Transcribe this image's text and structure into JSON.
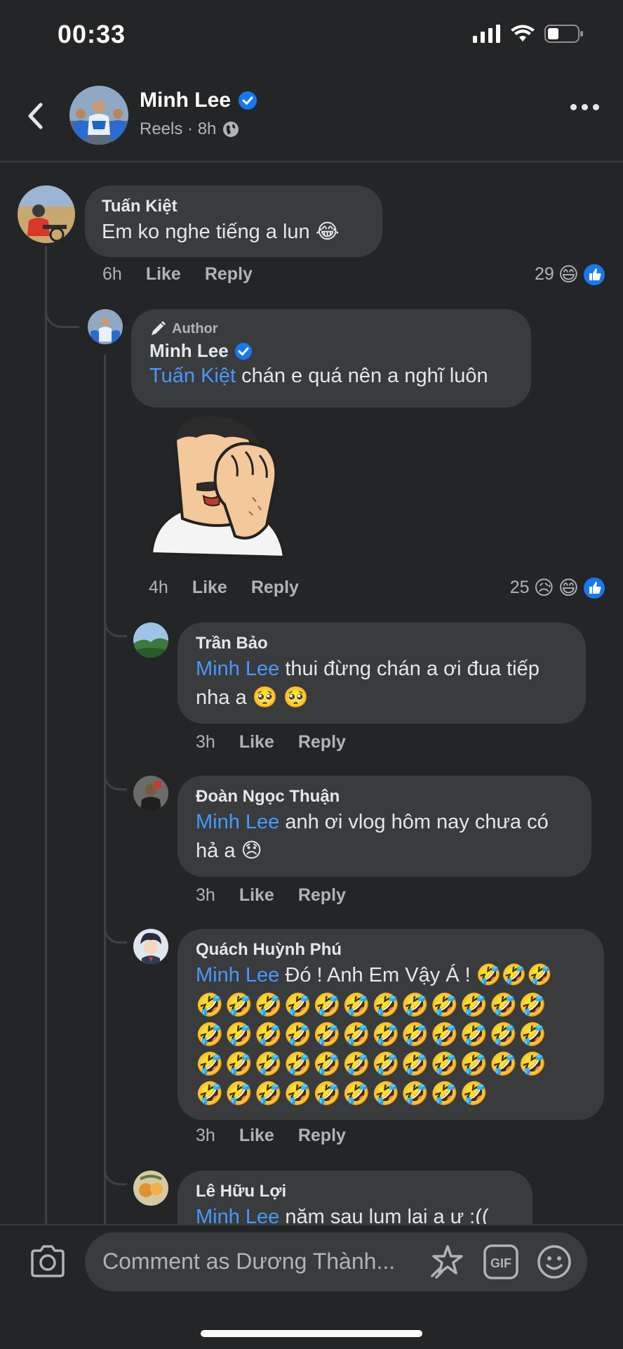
{
  "status_bar": {
    "time": "00:33"
  },
  "header": {
    "name": "Minh Lee",
    "subtitle": "Reels · 8h",
    "verified": true
  },
  "comments": [
    {
      "author": "Tuấn Kiệt",
      "text": "Em ko nghe tiếng a lun 😂",
      "time": "6h",
      "like": "Like",
      "reply": "Reply",
      "reaction_count": "29",
      "reactions": [
        "😄",
        "👍"
      ]
    },
    {
      "badge": "Author",
      "author": "Minh Lee",
      "mention": "Tuấn Kiệt",
      "text": " chán e quá nên a nghĩ luôn",
      "time": "4h",
      "like": "Like",
      "reply": "Reply",
      "reaction_count": "25",
      "reactions": [
        "😥",
        "😄",
        "👍"
      ]
    },
    {
      "author": "Trần Bảo",
      "mention": "Minh Lee",
      "text": " thui đừng chán a ơi đua tiếp",
      "text2": "nha a 🥺 🥺",
      "time": "3h",
      "like": "Like",
      "reply": "Reply"
    },
    {
      "author": "Đoàn Ngọc Thuận",
      "mention": "Minh Lee",
      "text": " anh ơi vlog hôm nay chưa có",
      "text2": "hả a 😞",
      "time": "3h",
      "like": "Like",
      "reply": "Reply"
    },
    {
      "author": "Quách Huỳnh Phú",
      "mention": "Minh Lee",
      "text": " Đó ! Anh Em Vậy Á ! 🤣🤣🤣",
      "emoji_rows": [
        "🤣🤣🤣🤣🤣🤣🤣🤣🤣🤣🤣🤣",
        "🤣🤣🤣🤣🤣🤣🤣🤣🤣🤣🤣🤣",
        "🤣🤣🤣🤣🤣🤣🤣🤣🤣🤣🤣🤣",
        "🤣🤣🤣🤣🤣🤣🤣🤣🤣🤣"
      ],
      "time": "3h",
      "like": "Like",
      "reply": "Reply"
    },
    {
      "author": "Lê Hữu Lợi",
      "mention": "Minh Lee",
      "text": " năm sau lum lại a ư :(("
    }
  ],
  "composer": {
    "placeholder": "Comment as Dương Thành..."
  },
  "colors": {
    "background": "#242526",
    "bubble": "#3a3b3c",
    "mention": "#4599ff",
    "verified": "#1877f2"
  }
}
